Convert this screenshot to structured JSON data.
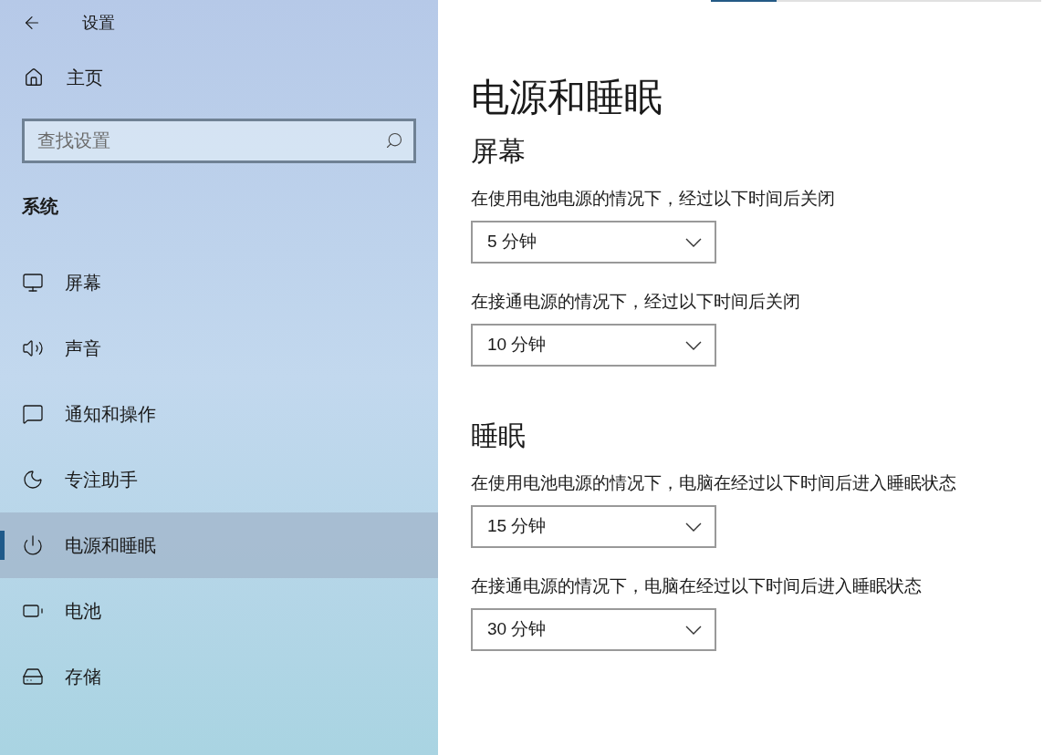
{
  "window": {
    "title": "设置"
  },
  "sidebar": {
    "home": "主页",
    "search": {
      "placeholder": "查找设置"
    },
    "section": "系统",
    "items": [
      {
        "label": "屏幕",
        "selected": false
      },
      {
        "label": "声音",
        "selected": false
      },
      {
        "label": "通知和操作",
        "selected": false
      },
      {
        "label": "专注助手",
        "selected": false
      },
      {
        "label": "电源和睡眠",
        "selected": true
      },
      {
        "label": "电池",
        "selected": false
      },
      {
        "label": "存储",
        "selected": false
      }
    ]
  },
  "top_bar": {
    "level": 0.2
  },
  "page": {
    "title": "电源和睡眠",
    "sections": [
      {
        "heading": "屏幕",
        "settings": [
          {
            "label": "在使用电池电源的情况下，经过以下时间后关闭",
            "value": "5 分钟"
          },
          {
            "label": "在接通电源的情况下，经过以下时间后关闭",
            "value": "10 分钟"
          }
        ]
      },
      {
        "heading": "睡眠",
        "settings": [
          {
            "label": "在使用电池电源的情况下，电脑在经过以下时间后进入睡眠状态",
            "value": "15 分钟"
          },
          {
            "label": "在接通电源的情况下，电脑在经过以下时间后进入睡眠状态",
            "value": "30 分钟"
          }
        ]
      }
    ]
  }
}
